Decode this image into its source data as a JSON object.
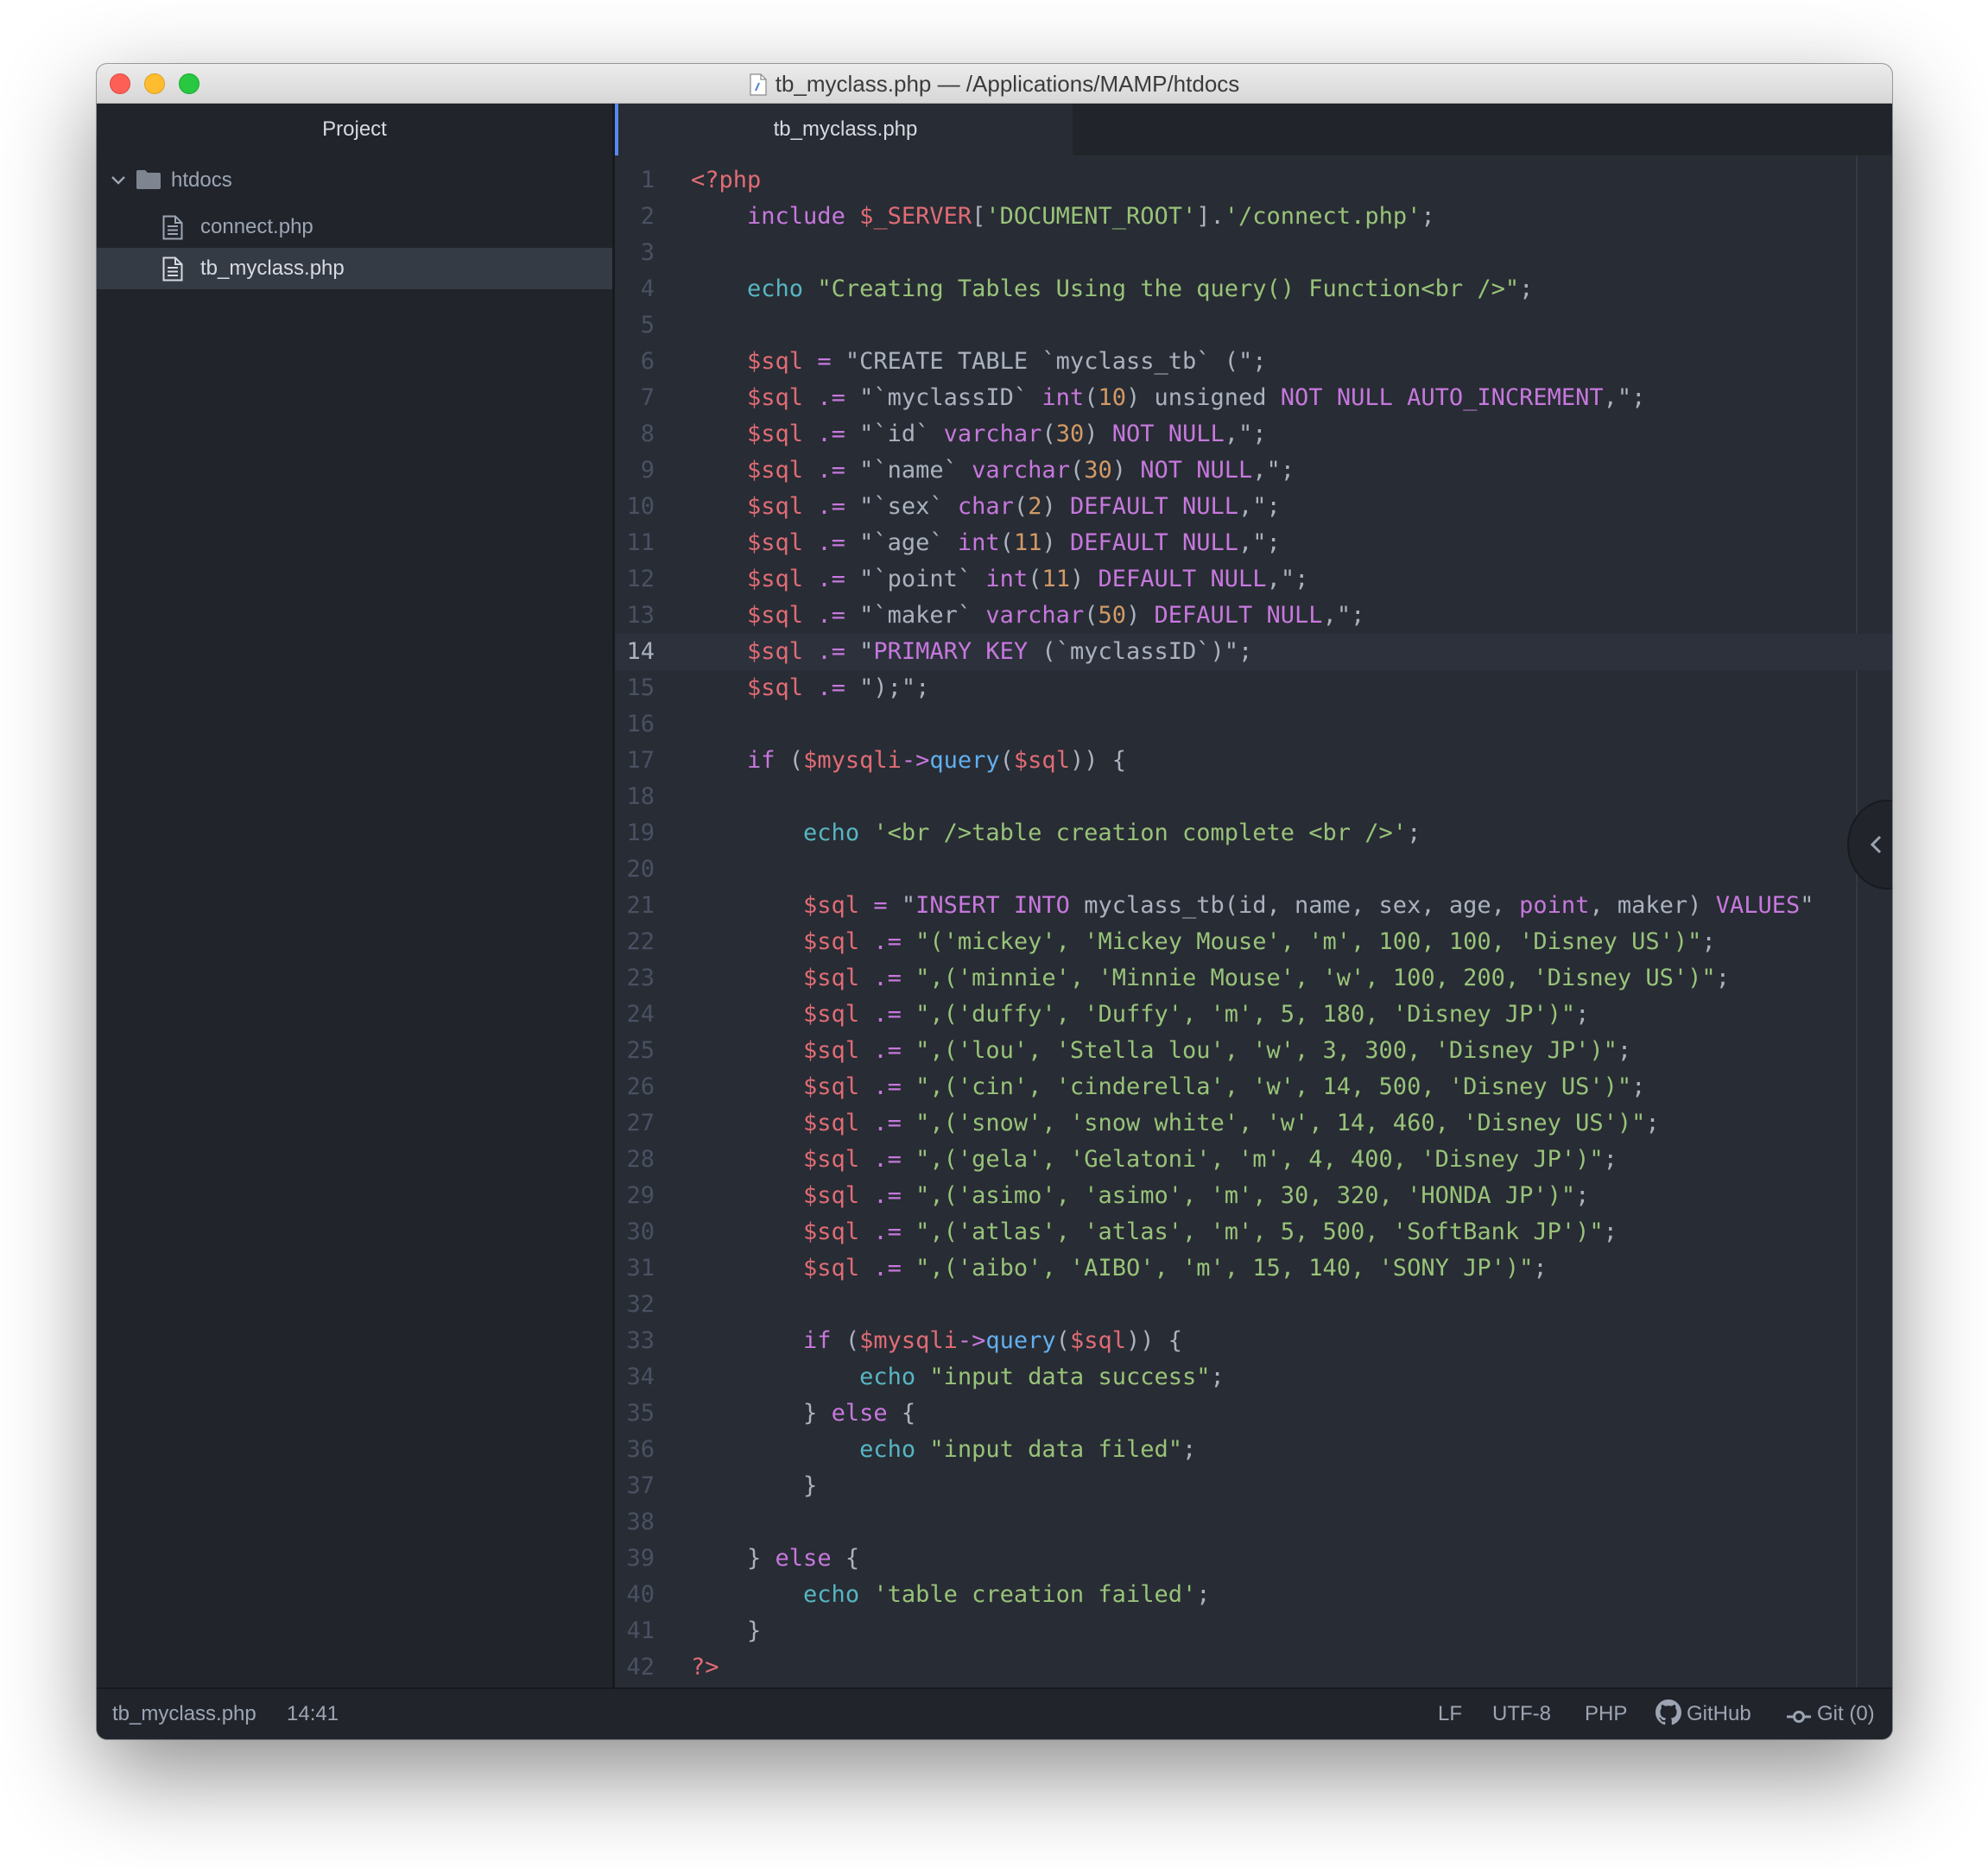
{
  "window": {
    "title": "tb_myclass.php — /Applications/MAMP/htdocs"
  },
  "sidebar": {
    "header": "Project",
    "root": {
      "label": "htdocs",
      "icon": "folder-icon",
      "expanded": true
    },
    "files": [
      {
        "label": "connect.php",
        "icon": "file-text-icon",
        "selected": false
      },
      {
        "label": "tb_myclass.php",
        "icon": "file-text-icon",
        "selected": true
      }
    ]
  },
  "tabs": [
    {
      "label": "tb_myclass.php",
      "active": true
    }
  ],
  "editor": {
    "cursor_line": 14,
    "lines": [
      [
        [
          "v",
          "<?php"
        ]
      ],
      [
        [
          "p",
          "    "
        ],
        [
          "k",
          "include"
        ],
        [
          "p",
          " "
        ],
        [
          "v",
          "$_SERVER"
        ],
        [
          "p",
          "["
        ],
        [
          "s",
          "'DOCUMENT_ROOT'"
        ],
        [
          "p",
          "]."
        ],
        [
          "s",
          "'/connect.php'"
        ],
        [
          "p",
          ";"
        ]
      ],
      [],
      [
        [
          "p",
          "    "
        ],
        [
          "c",
          "echo"
        ],
        [
          "p",
          " "
        ],
        [
          "s",
          "\"Creating Tables Using the query() Function<br />\""
        ],
        [
          "p",
          ";"
        ]
      ],
      [],
      [
        [
          "p",
          "    "
        ],
        [
          "v",
          "$sql"
        ],
        [
          "p",
          " "
        ],
        [
          "k",
          "="
        ],
        [
          "p",
          " \"CREATE TABLE `myclass_tb` (\";"
        ]
      ],
      [
        [
          "p",
          "    "
        ],
        [
          "v",
          "$sql"
        ],
        [
          "p",
          " "
        ],
        [
          "k",
          ".="
        ],
        [
          "p",
          " \"`myclassID` "
        ],
        [
          "k",
          "int"
        ],
        [
          "p",
          "("
        ],
        [
          "n",
          "10"
        ],
        [
          "p",
          ") unsigned "
        ],
        [
          "k",
          "NOT NULL AUTO_INCREMENT"
        ],
        [
          "p",
          ",\";"
        ]
      ],
      [
        [
          "p",
          "    "
        ],
        [
          "v",
          "$sql"
        ],
        [
          "p",
          " "
        ],
        [
          "k",
          ".="
        ],
        [
          "p",
          " \"`id` "
        ],
        [
          "k",
          "varchar"
        ],
        [
          "p",
          "("
        ],
        [
          "n",
          "30"
        ],
        [
          "p",
          ") "
        ],
        [
          "k",
          "NOT NULL"
        ],
        [
          "p",
          ",\";"
        ]
      ],
      [
        [
          "p",
          "    "
        ],
        [
          "v",
          "$sql"
        ],
        [
          "p",
          " "
        ],
        [
          "k",
          ".="
        ],
        [
          "p",
          " \"`name` "
        ],
        [
          "k",
          "varchar"
        ],
        [
          "p",
          "("
        ],
        [
          "n",
          "30"
        ],
        [
          "p",
          ") "
        ],
        [
          "k",
          "NOT NULL"
        ],
        [
          "p",
          ",\";"
        ]
      ],
      [
        [
          "p",
          "    "
        ],
        [
          "v",
          "$sql"
        ],
        [
          "p",
          " "
        ],
        [
          "k",
          ".="
        ],
        [
          "p",
          " \"`sex` "
        ],
        [
          "k",
          "char"
        ],
        [
          "p",
          "("
        ],
        [
          "n",
          "2"
        ],
        [
          "p",
          ") "
        ],
        [
          "k",
          "DEFAULT NULL"
        ],
        [
          "p",
          ",\";"
        ]
      ],
      [
        [
          "p",
          "    "
        ],
        [
          "v",
          "$sql"
        ],
        [
          "p",
          " "
        ],
        [
          "k",
          ".="
        ],
        [
          "p",
          " \"`age` "
        ],
        [
          "k",
          "int"
        ],
        [
          "p",
          "("
        ],
        [
          "n",
          "11"
        ],
        [
          "p",
          ") "
        ],
        [
          "k",
          "DEFAULT NULL"
        ],
        [
          "p",
          ",\";"
        ]
      ],
      [
        [
          "p",
          "    "
        ],
        [
          "v",
          "$sql"
        ],
        [
          "p",
          " "
        ],
        [
          "k",
          ".="
        ],
        [
          "p",
          " \"`point` "
        ],
        [
          "k",
          "int"
        ],
        [
          "p",
          "("
        ],
        [
          "n",
          "11"
        ],
        [
          "p",
          ") "
        ],
        [
          "k",
          "DEFAULT NULL"
        ],
        [
          "p",
          ",\";"
        ]
      ],
      [
        [
          "p",
          "    "
        ],
        [
          "v",
          "$sql"
        ],
        [
          "p",
          " "
        ],
        [
          "k",
          ".="
        ],
        [
          "p",
          " \"`maker` "
        ],
        [
          "k",
          "varchar"
        ],
        [
          "p",
          "("
        ],
        [
          "n",
          "50"
        ],
        [
          "p",
          ") "
        ],
        [
          "k",
          "DEFAULT NULL"
        ],
        [
          "p",
          ",\";"
        ]
      ],
      [
        [
          "p",
          "    "
        ],
        [
          "v",
          "$sql"
        ],
        [
          "p",
          " "
        ],
        [
          "k",
          ".="
        ],
        [
          "p",
          " \""
        ],
        [
          "k",
          "PRIMARY KEY"
        ],
        [
          "p",
          " (`myclassID`)\";"
        ]
      ],
      [
        [
          "p",
          "    "
        ],
        [
          "v",
          "$sql"
        ],
        [
          "p",
          " "
        ],
        [
          "k",
          ".="
        ],
        [
          "p",
          " \");\";"
        ]
      ],
      [],
      [
        [
          "p",
          "    "
        ],
        [
          "k",
          "if"
        ],
        [
          "p",
          " ("
        ],
        [
          "v",
          "$mysqli"
        ],
        [
          "k",
          "->"
        ],
        [
          "f",
          "query"
        ],
        [
          "p",
          "("
        ],
        [
          "v",
          "$sql"
        ],
        [
          "p",
          ")) {"
        ]
      ],
      [],
      [
        [
          "p",
          "        "
        ],
        [
          "c",
          "echo"
        ],
        [
          "p",
          " "
        ],
        [
          "s",
          "'<br />table creation complete <br />'"
        ],
        [
          "p",
          ";"
        ]
      ],
      [],
      [
        [
          "p",
          "        "
        ],
        [
          "v",
          "$sql"
        ],
        [
          "p",
          " "
        ],
        [
          "k",
          "="
        ],
        [
          "p",
          " \""
        ],
        [
          "k",
          "INSERT INTO"
        ],
        [
          "p",
          " myclass_tb(id, name, sex, age, "
        ],
        [
          "k",
          "point"
        ],
        [
          "p",
          ", maker) "
        ],
        [
          "k",
          "VALUES"
        ],
        [
          "p",
          "\""
        ]
      ],
      [
        [
          "p",
          "        "
        ],
        [
          "v",
          "$sql"
        ],
        [
          "p",
          " "
        ],
        [
          "k",
          ".="
        ],
        [
          "p",
          " "
        ],
        [
          "s",
          "\"('mickey', 'Mickey Mouse', 'm', 100, 100, 'Disney US')\""
        ],
        [
          "p",
          ";"
        ]
      ],
      [
        [
          "p",
          "        "
        ],
        [
          "v",
          "$sql"
        ],
        [
          "p",
          " "
        ],
        [
          "k",
          ".="
        ],
        [
          "p",
          " "
        ],
        [
          "s",
          "\",('minnie', 'Minnie Mouse', 'w', 100, 200, 'Disney US')\""
        ],
        [
          "p",
          ";"
        ]
      ],
      [
        [
          "p",
          "        "
        ],
        [
          "v",
          "$sql"
        ],
        [
          "p",
          " "
        ],
        [
          "k",
          ".="
        ],
        [
          "p",
          " "
        ],
        [
          "s",
          "\",('duffy', 'Duffy', 'm', 5, 180, 'Disney JP')\""
        ],
        [
          "p",
          ";"
        ]
      ],
      [
        [
          "p",
          "        "
        ],
        [
          "v",
          "$sql"
        ],
        [
          "p",
          " "
        ],
        [
          "k",
          ".="
        ],
        [
          "p",
          " "
        ],
        [
          "s",
          "\",('lou', 'Stella lou', 'w', 3, 300, 'Disney JP')\""
        ],
        [
          "p",
          ";"
        ]
      ],
      [
        [
          "p",
          "        "
        ],
        [
          "v",
          "$sql"
        ],
        [
          "p",
          " "
        ],
        [
          "k",
          ".="
        ],
        [
          "p",
          " "
        ],
        [
          "s",
          "\",('cin', 'cinderella', 'w', 14, 500, 'Disney US')\""
        ],
        [
          "p",
          ";"
        ]
      ],
      [
        [
          "p",
          "        "
        ],
        [
          "v",
          "$sql"
        ],
        [
          "p",
          " "
        ],
        [
          "k",
          ".="
        ],
        [
          "p",
          " "
        ],
        [
          "s",
          "\",('snow', 'snow white', 'w', 14, 460, 'Disney US')\""
        ],
        [
          "p",
          ";"
        ]
      ],
      [
        [
          "p",
          "        "
        ],
        [
          "v",
          "$sql"
        ],
        [
          "p",
          " "
        ],
        [
          "k",
          ".="
        ],
        [
          "p",
          " "
        ],
        [
          "s",
          "\",('gela', 'Gelatoni', 'm', 4, 400, 'Disney JP')\""
        ],
        [
          "p",
          ";"
        ]
      ],
      [
        [
          "p",
          "        "
        ],
        [
          "v",
          "$sql"
        ],
        [
          "p",
          " "
        ],
        [
          "k",
          ".="
        ],
        [
          "p",
          " "
        ],
        [
          "s",
          "\",('asimo', 'asimo', 'm', 30, 320, 'HONDA JP')\""
        ],
        [
          "p",
          ";"
        ]
      ],
      [
        [
          "p",
          "        "
        ],
        [
          "v",
          "$sql"
        ],
        [
          "p",
          " "
        ],
        [
          "k",
          ".="
        ],
        [
          "p",
          " "
        ],
        [
          "s",
          "\",('atlas', 'atlas', 'm', 5, 500, 'SoftBank JP')\""
        ],
        [
          "p",
          ";"
        ]
      ],
      [
        [
          "p",
          "        "
        ],
        [
          "v",
          "$sql"
        ],
        [
          "p",
          " "
        ],
        [
          "k",
          ".="
        ],
        [
          "p",
          " "
        ],
        [
          "s",
          "\",('aibo', 'AIBO', 'm', 15, 140, 'SONY JP')\""
        ],
        [
          "p",
          ";"
        ]
      ],
      [],
      [
        [
          "p",
          "        "
        ],
        [
          "k",
          "if"
        ],
        [
          "p",
          " ("
        ],
        [
          "v",
          "$mysqli"
        ],
        [
          "k",
          "->"
        ],
        [
          "f",
          "query"
        ],
        [
          "p",
          "("
        ],
        [
          "v",
          "$sql"
        ],
        [
          "p",
          ")) {"
        ]
      ],
      [
        [
          "p",
          "            "
        ],
        [
          "c",
          "echo"
        ],
        [
          "p",
          " "
        ],
        [
          "s",
          "\"input data success\""
        ],
        [
          "p",
          ";"
        ]
      ],
      [
        [
          "p",
          "        } "
        ],
        [
          "k",
          "else"
        ],
        [
          "p",
          " {"
        ]
      ],
      [
        [
          "p",
          "            "
        ],
        [
          "c",
          "echo"
        ],
        [
          "p",
          " "
        ],
        [
          "s",
          "\"input data filed\""
        ],
        [
          "p",
          ";"
        ]
      ],
      [
        [
          "p",
          "        }"
        ]
      ],
      [],
      [
        [
          "p",
          "    } "
        ],
        [
          "k",
          "else"
        ],
        [
          "p",
          " {"
        ]
      ],
      [
        [
          "p",
          "        "
        ],
        [
          "c",
          "echo"
        ],
        [
          "p",
          " "
        ],
        [
          "s",
          "'table creation failed'"
        ],
        [
          "p",
          ";"
        ]
      ],
      [
        [
          "p",
          "    }"
        ]
      ],
      [
        [
          "v",
          "?>"
        ]
      ]
    ]
  },
  "statusbar": {
    "file": "tb_myclass.php",
    "cursor": "14:41",
    "line_ending": "LF",
    "encoding": "UTF-8",
    "grammar": "PHP",
    "github": "GitHub",
    "git": "Git (0)"
  },
  "colors": {
    "accent": "#568af2",
    "keyword": "#c678dd",
    "variable": "#e06c75",
    "string": "#98c379",
    "number": "#d19a66",
    "function": "#61afef",
    "builtin": "#56b6c2"
  }
}
